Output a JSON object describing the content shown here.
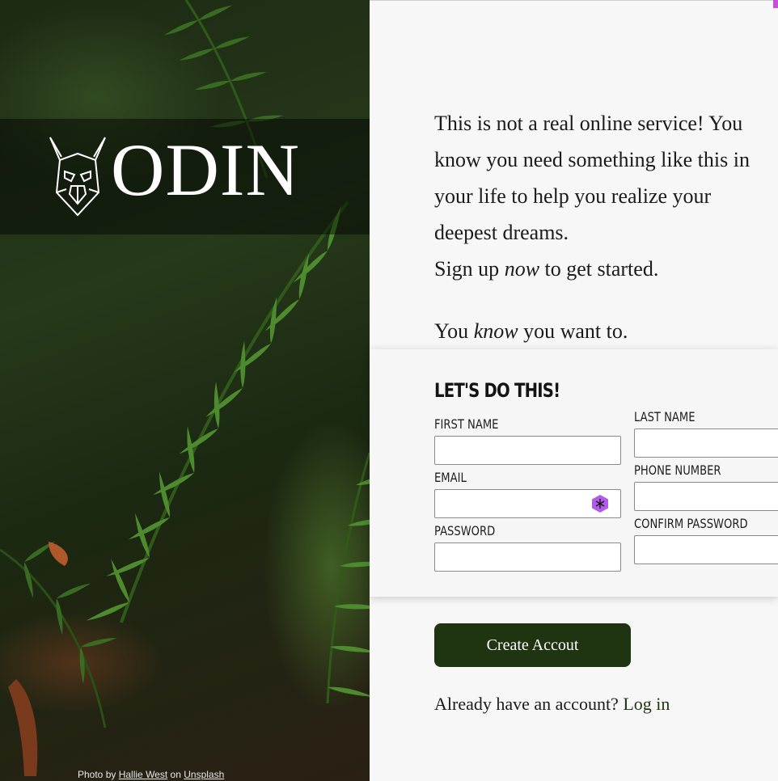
{
  "brand": {
    "name": "ODIN",
    "logo_icon": "viking-helmet-icon"
  },
  "photo_credit": {
    "prefix": "Photo by",
    "author": "Hallie West",
    "middle": "on",
    "source": "Unsplash"
  },
  "intro": {
    "lines": [
      "This is not a real online service! You",
      "know you need something like this in",
      "your life to help you realize your",
      "deepest dreams."
    ],
    "signup": {
      "before": "Sign up ",
      "emphasis": "now",
      "after": " to get started."
    },
    "want": {
      "before": "You ",
      "emphasis": "know",
      "after": " you want to."
    }
  },
  "form": {
    "title": "LET'S DO THIS!",
    "first_name": {
      "label": "FIRST NAME",
      "value": ""
    },
    "last_name": {
      "label": "LAST NAME",
      "value": ""
    },
    "email": {
      "label": "EMAIL",
      "value": "",
      "extension_icon": "password-manager-icon"
    },
    "phone": {
      "label": "PHONE NUMBER",
      "value": ""
    },
    "password": {
      "label": "PASSWORD",
      "value": ""
    },
    "confirm_password": {
      "label": "CONFIRM PASSWORD",
      "value": ""
    }
  },
  "actions": {
    "create_label": "Create Accout",
    "login_prompt": "Already have an account?",
    "login_link": "Log in"
  },
  "colors": {
    "button": "#1f3512",
    "accent": "#c54fd9",
    "background": "#f7f7f7"
  }
}
